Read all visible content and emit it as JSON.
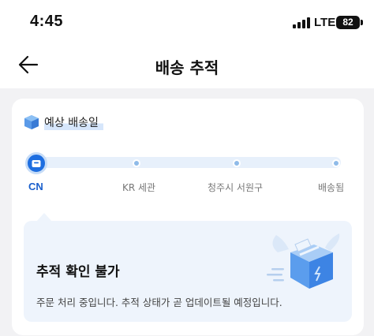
{
  "status_bar": {
    "time": "4:45",
    "network": "LTE",
    "battery": "82"
  },
  "header": {
    "title": "배송 추적",
    "back_icon": "arrow-left-icon"
  },
  "delivery": {
    "eta_label": "예상 배송일",
    "eta_icon": "package-icon",
    "stages": [
      {
        "label": "CN",
        "active": true
      },
      {
        "label": "KR 세관",
        "active": false
      },
      {
        "label": "청주시 서원구",
        "active": false
      },
      {
        "label": "배송됨",
        "active": false
      }
    ],
    "current_icon": "package-icon"
  },
  "notice": {
    "title": "추적 확인 불가",
    "message": "주문 처리 중입니다. 추적 상태가 곧 업데이트될 예정입니다.",
    "illustration": "flying-box-icon"
  },
  "colors": {
    "accent": "#1e6ee0",
    "track": "#e7f0fb",
    "notice_bg": "#eef4fc"
  }
}
